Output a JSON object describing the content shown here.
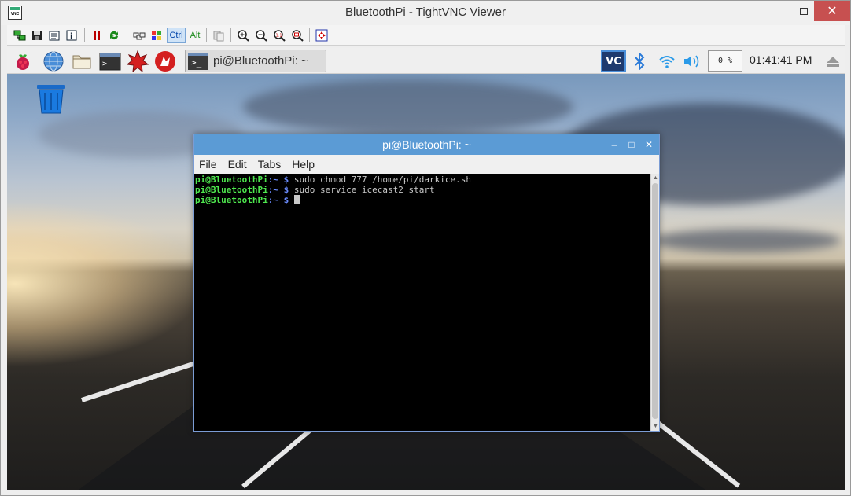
{
  "window": {
    "title": "BluetoothPi - TightVNC Viewer",
    "app_icon_label": "VNC",
    "close_glyph": "✕"
  },
  "vnc_toolbar": {
    "buttons": [
      {
        "name": "new-connection-icon"
      },
      {
        "name": "save-icon"
      },
      {
        "name": "options-icon"
      },
      {
        "name": "info-icon"
      },
      {
        "name": "pause-icon"
      },
      {
        "name": "refresh-icon"
      },
      {
        "name": "send-ctrl-alt-del-icon"
      },
      {
        "name": "send-ctrl-esc-icon"
      }
    ],
    "ctrl_label": "Ctrl",
    "alt_label": "Alt"
  },
  "panel": {
    "task_label": "pi@BluetoothPi: ~",
    "cpu_usage": "0 %",
    "clock": "01:41:41 PM",
    "vnc_tray_label": "VC"
  },
  "terminal": {
    "title": "pi@BluetoothPi: ~",
    "min_glyph": "–",
    "max_glyph": "□",
    "close_glyph": "✕",
    "menu": [
      "File",
      "Edit",
      "Tabs",
      "Help"
    ],
    "lines": [
      {
        "user": "pi@BluetoothPi",
        "path": ":~ $",
        "cmd": " sudo chmod 777 /home/pi/darkice.sh"
      },
      {
        "user": "pi@BluetoothPi",
        "path": ":~ $",
        "cmd": " sudo service icecast2 start"
      },
      {
        "user": "pi@BluetoothPi",
        "path": ":~ $",
        "cmd": " "
      }
    ]
  },
  "colors": {
    "terminal_title_bg": "#5b9bd5",
    "prompt_user": "#4ee84e",
    "prompt_path": "#6b8cff",
    "window_close_bg": "#c75050"
  }
}
